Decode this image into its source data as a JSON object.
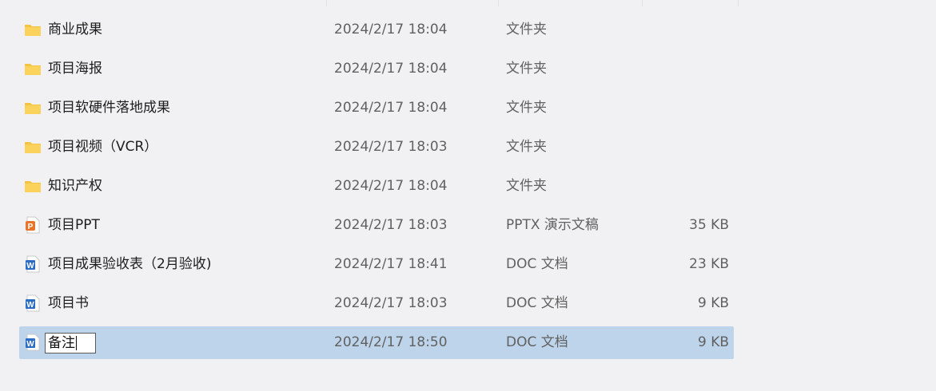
{
  "files": [
    {
      "name": "商业成果",
      "modified": "2024/2/17 18:04",
      "type": "文件夹",
      "size": "",
      "icon": "folder-icon"
    },
    {
      "name": "项目海报",
      "modified": "2024/2/17 18:04",
      "type": "文件夹",
      "size": "",
      "icon": "folder-icon"
    },
    {
      "name": "项目软硬件落地成果",
      "modified": "2024/2/17 18:04",
      "type": "文件夹",
      "size": "",
      "icon": "folder-icon"
    },
    {
      "name": "项目视频（VCR）",
      "modified": "2024/2/17 18:03",
      "type": "文件夹",
      "size": "",
      "icon": "folder-icon"
    },
    {
      "name": "知识产权",
      "modified": "2024/2/17 18:04",
      "type": "文件夹",
      "size": "",
      "icon": "folder-icon"
    },
    {
      "name": "项目PPT",
      "modified": "2024/2/17 18:03",
      "type": "PPTX 演示文稿",
      "size": "35 KB",
      "icon": "pptx-file-icon"
    },
    {
      "name": "项目成果验收表（2月验收)",
      "modified": "2024/2/17 18:41",
      "type": "DOC 文档",
      "size": "23 KB",
      "icon": "word-file-icon"
    },
    {
      "name": "项目书",
      "modified": "2024/2/17 18:03",
      "type": "DOC 文档",
      "size": "9 KB",
      "icon": "word-file-icon"
    },
    {
      "name": "备注",
      "modified": "2024/2/17 18:50",
      "type": "DOC 文档",
      "size": "9 KB",
      "icon": "word-file-icon",
      "selected": true,
      "renaming": true
    }
  ],
  "colors": {
    "background": "#f1f1f3",
    "selection": "#bdd4ea",
    "folder": "#f5c342",
    "pptx": "#e8742a",
    "word": "#2b6cc4"
  }
}
